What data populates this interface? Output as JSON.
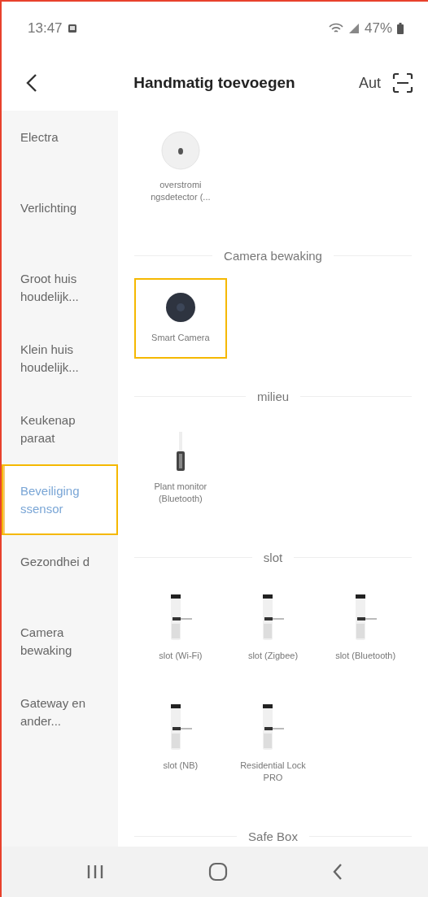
{
  "status_bar": {
    "time": "13:47",
    "battery": "47%"
  },
  "header": {
    "title": "Handmatig toevoegen",
    "action": "Aut"
  },
  "sidebar": {
    "items": [
      {
        "label": "Electra",
        "selected": false,
        "highlighted": false
      },
      {
        "label": "Verlichting",
        "selected": false,
        "highlighted": false
      },
      {
        "label": "Groot huis houdelijk...",
        "selected": false,
        "highlighted": false
      },
      {
        "label": "Klein huis houdelijk...",
        "selected": false,
        "highlighted": false
      },
      {
        "label": "Keukenap paraat",
        "selected": false,
        "highlighted": false
      },
      {
        "label": "Beveiliging ssensor",
        "selected": true,
        "highlighted": true
      },
      {
        "label": "Gezondhei d",
        "selected": false,
        "highlighted": false
      },
      {
        "label": "Camera bewaking",
        "selected": false,
        "highlighted": false
      },
      {
        "label": "Gateway en ander...",
        "selected": false,
        "highlighted": false
      }
    ]
  },
  "sections": [
    {
      "devices": [
        {
          "kind": "sensor",
          "name": "overstromi ngsdetector (...",
          "highlighted": false
        }
      ]
    },
    {
      "title": "Camera bewaking",
      "devices": [
        {
          "kind": "camera",
          "name": "Smart Camera",
          "highlighted": true
        }
      ]
    },
    {
      "title": "milieu",
      "devices": [
        {
          "kind": "stick",
          "name": "Plant monitor (Bluetooth)",
          "highlighted": false
        }
      ]
    },
    {
      "title": "slot",
      "devices": [
        {
          "kind": "lock",
          "name": "slot (Wi-Fi)",
          "highlighted": false
        },
        {
          "kind": "lock",
          "name": "slot (Zigbee)",
          "highlighted": false
        },
        {
          "kind": "lock",
          "name": "slot (Bluetooth)",
          "highlighted": false
        },
        {
          "kind": "lock",
          "name": "slot (NB)",
          "highlighted": false
        },
        {
          "kind": "lock",
          "name": "Residential Lock PRO",
          "highlighted": false
        }
      ]
    },
    {
      "title": "Safe Box"
    }
  ]
}
